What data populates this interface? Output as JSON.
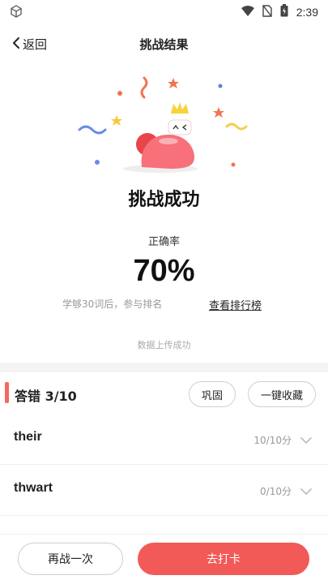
{
  "status": {
    "time": "2:39"
  },
  "nav": {
    "back_label": "返回",
    "title": "挑战结果"
  },
  "result": {
    "headline": "挑战成功",
    "accuracy_label": "正确率",
    "accuracy_value": "70%",
    "hint": "学够30词后，参与排名",
    "rank_link": "查看排行榜",
    "upload_status": "数据上传成功"
  },
  "wrong": {
    "label": "答错 3/10",
    "consolidate_label": "巩固",
    "collect_all_label": "一键收藏",
    "items": [
      {
        "word": "their",
        "score": "10/10分"
      },
      {
        "word": "thwart",
        "score": "0/10分"
      }
    ]
  },
  "actions": {
    "retry_label": "再战一次",
    "checkin_label": "去打卡"
  },
  "colors": {
    "accent": "#f25a57",
    "mascot": "#f7707a",
    "crown": "#f8d23a"
  },
  "icons": [
    "cube-icon",
    "wifi-icon",
    "no-sim-icon",
    "battery-icon",
    "back-chevron-icon",
    "chevron-down-icon"
  ]
}
